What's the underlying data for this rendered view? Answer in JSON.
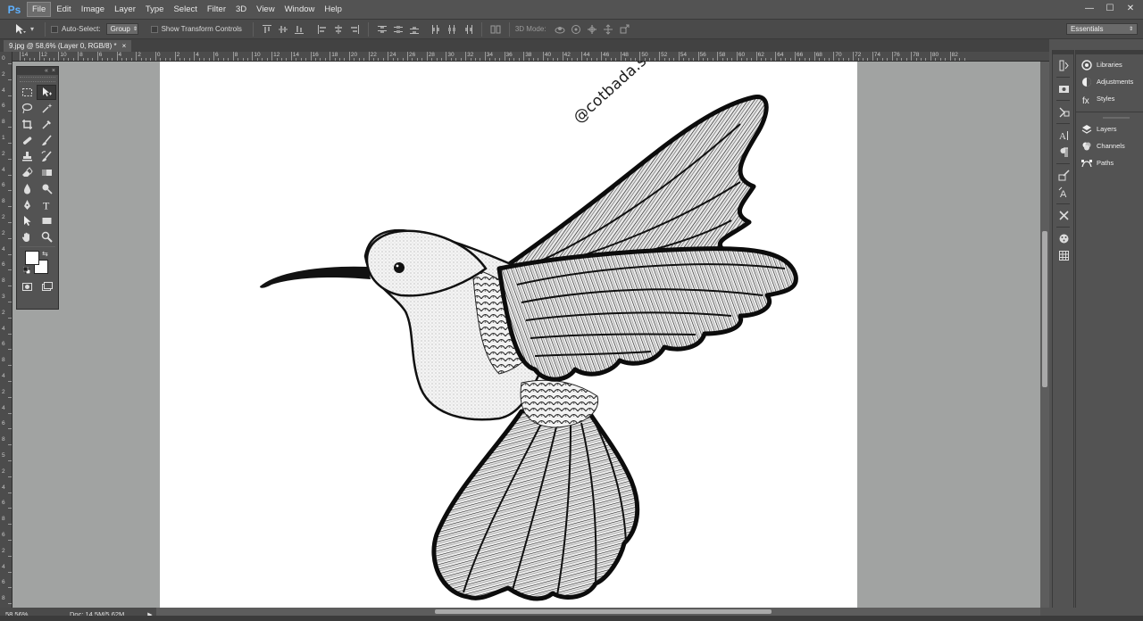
{
  "app": {
    "logo": "Ps",
    "menu": [
      "File",
      "Edit",
      "Image",
      "Layer",
      "Type",
      "Select",
      "Filter",
      "3D",
      "View",
      "Window",
      "Help"
    ],
    "active_menu": "File",
    "window_controls": [
      "—",
      "☐",
      "✕"
    ]
  },
  "options_bar": {
    "tool_icon": "move-tool-icon",
    "auto_select_label": "Auto-Select:",
    "auto_select_value": "Group",
    "show_transform_label": "Show Transform Controls",
    "mode_3d_label": "3D Mode:",
    "workspace": "Essentials"
  },
  "document": {
    "tab_title": "9.jpg @ 58,6% (Layer 0, RGB/8) *",
    "tab_close": "×",
    "watermark": "@cotbada.studio"
  },
  "rulers": {
    "top_labels": [
      "14",
      "12",
      "10",
      "8",
      "6",
      "4",
      "2",
      "0",
      "2",
      "4",
      "6",
      "8",
      "10",
      "12",
      "14",
      "16",
      "18",
      "20",
      "22",
      "24",
      "26",
      "28",
      "30",
      "32",
      "34",
      "36",
      "38",
      "40",
      "42",
      "44",
      "46",
      "48",
      "50",
      "52",
      "54",
      "56",
      "58",
      "60",
      "62",
      "64",
      "66",
      "68",
      "70",
      "72",
      "74",
      "76",
      "78",
      "80",
      "82"
    ],
    "left_labels": [
      "0",
      "2",
      "4",
      "6",
      "8",
      "1",
      "2",
      "4",
      "6",
      "8",
      "2",
      "2",
      "4",
      "6",
      "8",
      "3",
      "2",
      "4",
      "6",
      "8",
      "4",
      "2",
      "4",
      "6",
      "8",
      "5",
      "2",
      "4",
      "6",
      "8",
      "6",
      "2",
      "4",
      "6",
      "8"
    ]
  },
  "status": {
    "zoom": "58,56%",
    "doc_size": "Doc: 14,5M/5,62M"
  },
  "tools_panel": {
    "header_buttons": [
      "«",
      "×"
    ],
    "tools": [
      [
        "marquee-tool-icon",
        "move-tool-icon"
      ],
      [
        "lasso-tool-icon",
        "magic-wand-tool-icon"
      ],
      [
        "crop-tool-icon",
        "eyedropper-tool-icon"
      ],
      [
        "healing-brush-tool-icon",
        "brush-tool-icon"
      ],
      [
        "clone-stamp-tool-icon",
        "history-brush-tool-icon"
      ],
      [
        "eraser-tool-icon",
        "gradient-tool-icon"
      ],
      [
        "blur-tool-icon",
        "dodge-tool-icon"
      ],
      [
        "pen-tool-icon",
        "type-tool-icon"
      ],
      [
        "path-selection-tool-icon",
        "rectangle-tool-icon"
      ],
      [
        "hand-tool-icon",
        "zoom-tool-icon"
      ]
    ],
    "foreground_color": "#ffffff",
    "background_color": "#ffffff"
  },
  "right_panel": {
    "group1": [
      "Libraries",
      "Adjustments",
      "Styles"
    ],
    "group2": [
      "Layers",
      "Channels",
      "Paths"
    ]
  },
  "colors": {
    "ui_dark": "#535353",
    "canvas_bg": "#a1a3a2",
    "document_bg": "#ffffff",
    "accent": "#5fb1ff"
  }
}
